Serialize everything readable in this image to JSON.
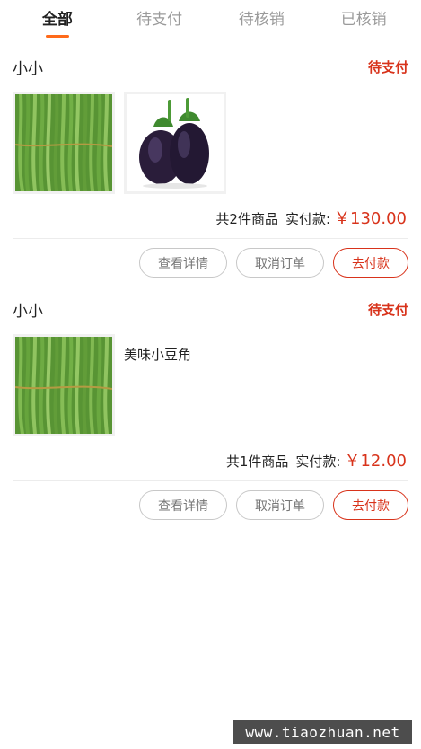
{
  "tabs": [
    {
      "label": "全部",
      "active": true
    },
    {
      "label": "待支付",
      "active": false
    },
    {
      "label": "待核销",
      "active": false
    },
    {
      "label": "已核销",
      "active": false
    }
  ],
  "orders": [
    {
      "shop_name": "小小",
      "status": "待支付",
      "products": [
        {
          "image": "green-beans-image",
          "name": ""
        },
        {
          "image": "eggplant-image",
          "name": ""
        }
      ],
      "item_count_text": "共2件商品",
      "paid_label": "实付款:",
      "amount": "￥130.00",
      "buttons": {
        "details": "查看详情",
        "cancel": "取消订单",
        "pay": "去付款"
      }
    },
    {
      "shop_name": "小小",
      "status": "待支付",
      "products": [
        {
          "image": "green-beans-image",
          "name": "美味小豆角"
        }
      ],
      "item_count_text": "共1件商品",
      "paid_label": "实付款:",
      "amount": "￥12.00",
      "buttons": {
        "details": "查看详情",
        "cancel": "取消订单",
        "pay": "去付款"
      }
    }
  ],
  "watermark": "www.tiaozhuan.net",
  "colors": {
    "accent": "#ff6a1a",
    "status_red": "#d8331b",
    "muted_text": "#9a9a9a",
    "watermark_bg": "#4d4d4d"
  }
}
